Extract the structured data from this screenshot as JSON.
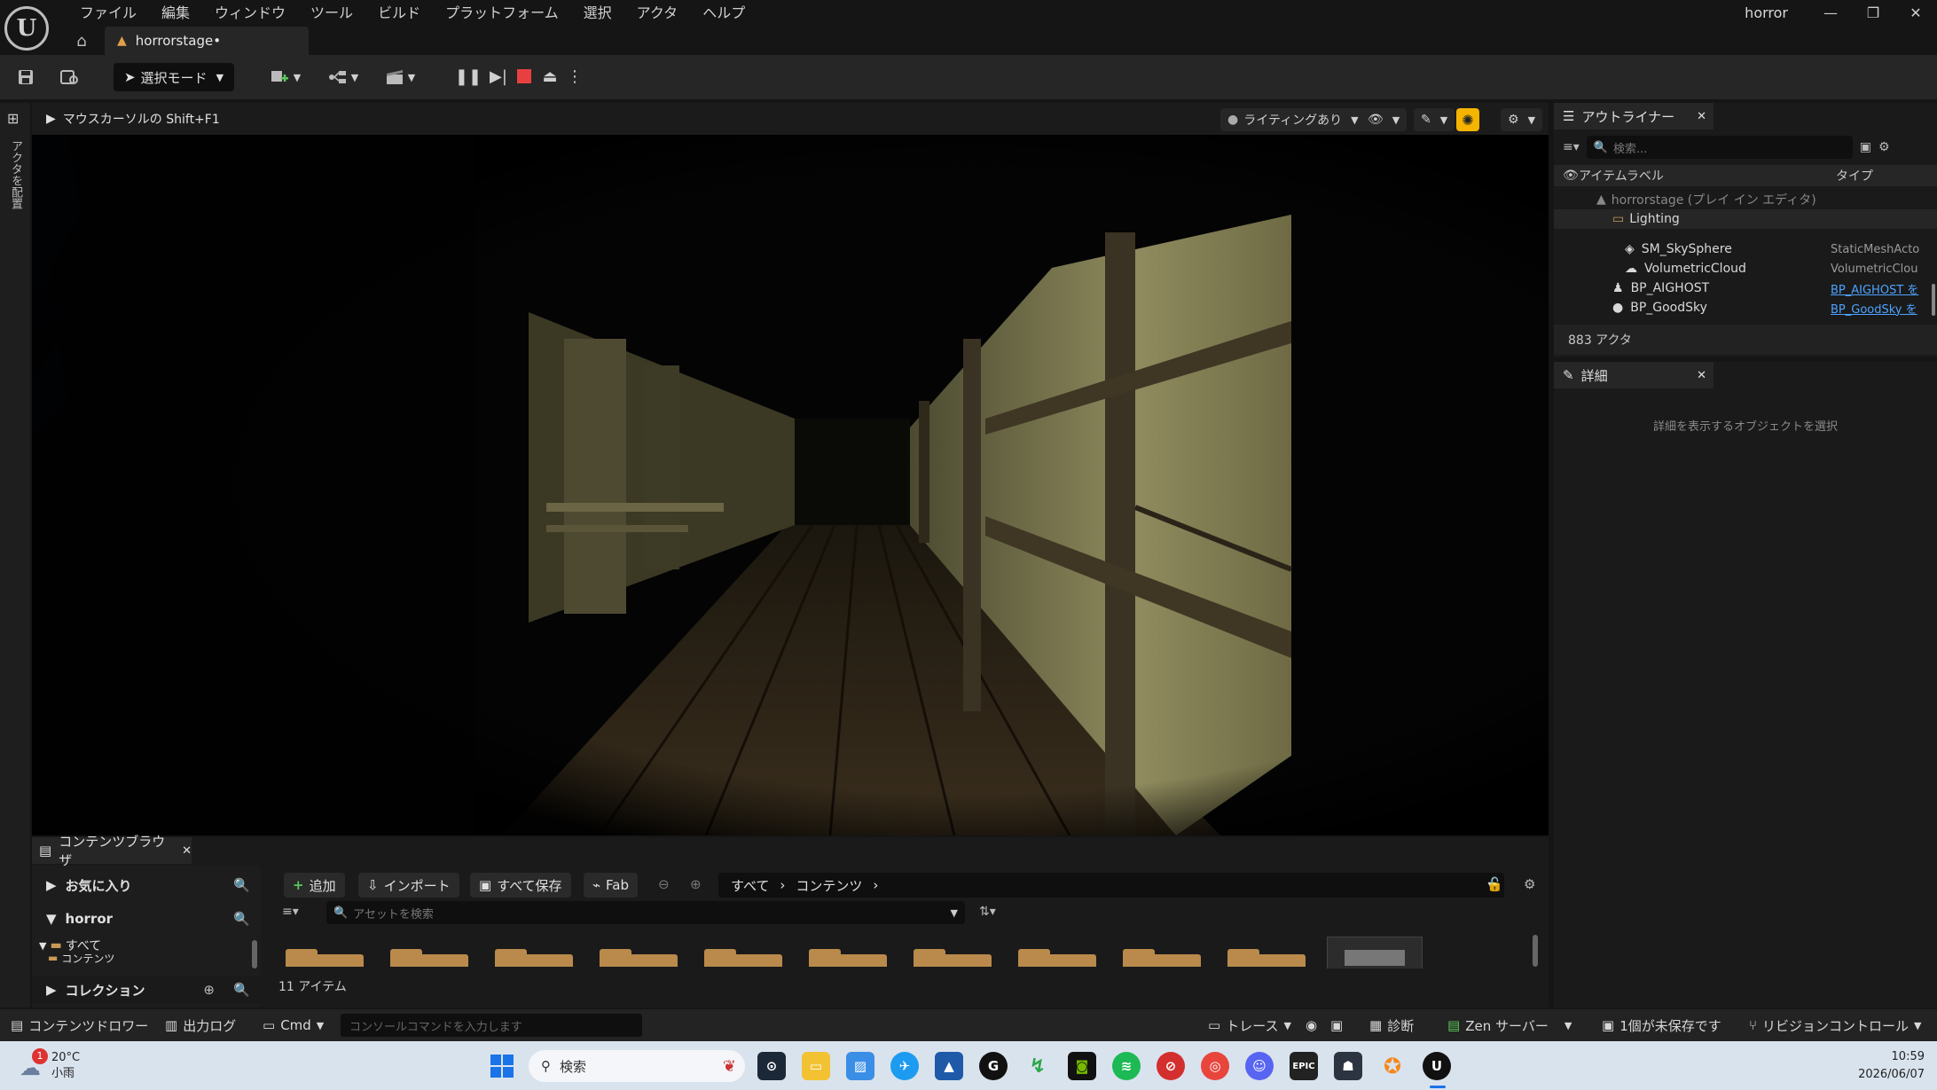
{
  "menu": [
    "ファイル",
    "編集",
    "ウィンドウ",
    "ツール",
    "ビルド",
    "プラットフォーム",
    "選択",
    "アクタ",
    "ヘルプ"
  ],
  "tab": {
    "title": "horrorstage•"
  },
  "project_name": "horror",
  "window_controls": {
    "minimize": "—",
    "restore": "❐",
    "close": "✕"
  },
  "toolbar": {
    "mode_label": "選択モード"
  },
  "left_strip": {
    "place_actors": "アクタを配置"
  },
  "viewport": {
    "hint": "マウスカーソルの Shift+F1",
    "lighting_label": "ライティングあり"
  },
  "outliner": {
    "tab_label": "アウトライナー",
    "search_placeholder": "検索...",
    "col_label": "アイテムラベル",
    "col_type": "タイプ",
    "rows": [
      {
        "label": "horrorstage (プレイ イン エディタ)",
        "type": ""
      },
      {
        "label": "Lighting",
        "type": ""
      },
      {
        "label": "SM_SkySphere",
        "type": "StaticMeshActo"
      },
      {
        "label": "VolumetricCloud",
        "type": "VolumetricClou"
      },
      {
        "label": "BP_AIGHOST",
        "type": "BP_AIGHOST を"
      },
      {
        "label": "BP_GoodSky",
        "type": "BP_GoodSky を"
      }
    ],
    "actor_count": "883 アクタ"
  },
  "details": {
    "tab_label": "詳細",
    "empty_message": "詳細を表示するオブジェクトを選択"
  },
  "content_browser": {
    "tab_label": "コンテンツブラウザ",
    "favorites": "お気に入り",
    "project": "horror",
    "tree_all": "すべて",
    "tree_content": "コンテンツ",
    "collections": "コレクション",
    "add_button": "追加",
    "import_button": "インポート",
    "save_all_button": "すべて保存",
    "fab_button": "Fab",
    "breadcrumb_all": "すべて",
    "breadcrumb_content": "コンテンツ",
    "search_placeholder": "アセットを検索",
    "item_count": "11 アイテム"
  },
  "statusbar": {
    "content_drawer": "コンテンツドロワー",
    "output_log": "出力ログ",
    "cmd": "Cmd",
    "console_placeholder": "コンソールコマンドを入力します",
    "trace": "トレース",
    "diagnostics": "診断",
    "zen_server": "Zen サーバー",
    "unsaved": "1個が未保存です",
    "revision_control": "リビジョンコントロール"
  },
  "taskbar": {
    "weather_temp": "20°C",
    "weather_desc": "小雨",
    "weather_badge": "1",
    "search_label": "検索",
    "time": "10:59",
    "date": "2026/06/07"
  },
  "colors": {
    "accent_orange": "#f5b400",
    "stop_red": "#e84040",
    "link_blue": "#4da3ff",
    "folder": "#b98a4c"
  }
}
